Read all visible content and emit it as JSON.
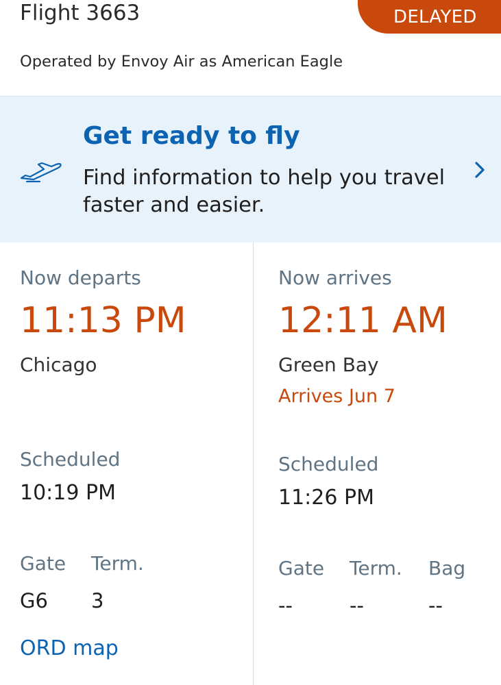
{
  "header": {
    "flight_title": "Flight 3663",
    "status": "DELAYED",
    "operated_by": "Operated by Envoy Air as American Eagle"
  },
  "promo": {
    "icon": "airplane-takeoff-icon",
    "title": "Get ready to fly",
    "description": "Find information to help you travel faster and easier.",
    "chevron_icon": "chevron-right-icon"
  },
  "departure": {
    "label": "Now departs",
    "time": "11:13 PM",
    "city": "Chicago",
    "scheduled_label": "Scheduled",
    "scheduled_time": "10:19 PM",
    "gate_label": "Gate",
    "gate_value": "G6",
    "term_label": "Term.",
    "term_value": "3",
    "map_link": "ORD map"
  },
  "arrival": {
    "label": "Now arrives",
    "time": "12:11 AM",
    "city": "Green Bay",
    "arrives_note": "Arrives Jun 7",
    "scheduled_label": "Scheduled",
    "scheduled_time": "11:26 PM",
    "gate_label": "Gate",
    "gate_value": "--",
    "term_label": "Term.",
    "term_value": "--",
    "bag_label": "Bag",
    "bag_value": "--"
  },
  "colors": {
    "accent_orange": "#c8490b",
    "link_blue": "#0b63b1",
    "label_gray": "#607483",
    "promo_background": "#e8f2fb"
  }
}
